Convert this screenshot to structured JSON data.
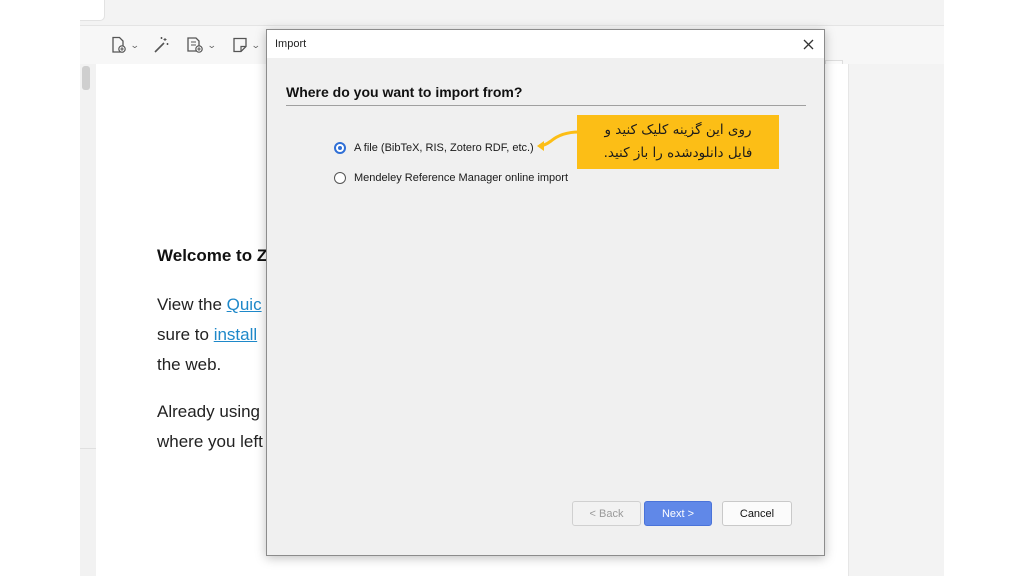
{
  "background_page": {
    "welcome_title": "Welcome to Z",
    "line1_prefix": "View the ",
    "line1_link": "Quic",
    "line2_prefix": "sure to ",
    "line2_link": "install",
    "line3": "the web.",
    "line4": "Already using",
    "line5": "where you left"
  },
  "toolbar": {
    "icons": [
      "new-item-icon",
      "magic-wand-icon",
      "add-attachment-icon",
      "new-note-icon"
    ]
  },
  "dialog": {
    "title": "Import",
    "heading": "Where do you want to import from?",
    "options": [
      {
        "label": "A file (BibTeX, RIS, Zotero RDF, etc.)",
        "selected": true
      },
      {
        "label": "Mendeley Reference Manager online import",
        "selected": false
      }
    ],
    "buttons": {
      "back": "< Back",
      "next": "Next >",
      "cancel": "Cancel"
    }
  },
  "annotation": {
    "line1": "روی این گزینه کلیک کنید و",
    "line2": "فایل دانلودشده را باز کنید.",
    "background_color": "#fcbe16"
  },
  "colors": {
    "accent": "#2f6fd6",
    "next_button": "#6088e8",
    "link": "#1e88c9"
  }
}
